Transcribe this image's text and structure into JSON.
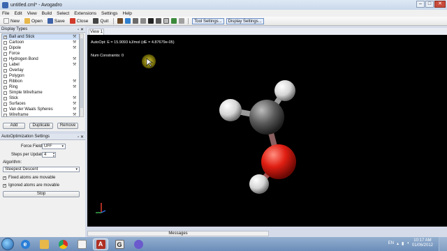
{
  "window": {
    "title": "untitled.cml* - Avogadro"
  },
  "menu": [
    "File",
    "Edit",
    "View",
    "Build",
    "Select",
    "Extensions",
    "Settings",
    "Help"
  ],
  "toolbar": {
    "new_label": "New",
    "open_label": "Open",
    "save_label": "Save",
    "close_label": "Close",
    "quit_label": "Quit",
    "tool_settings_label": "Tool Settings...",
    "display_settings_label": "Display Settings..."
  },
  "display_types": {
    "header": "Display Types",
    "items": [
      {
        "label": "Ball and Stick",
        "checked": true,
        "wrench": true,
        "selected": true
      },
      {
        "label": "Cartoon",
        "checked": false,
        "wrench": true
      },
      {
        "label": "Dipole",
        "checked": false,
        "wrench": true
      },
      {
        "label": "Force",
        "checked": false,
        "wrench": false
      },
      {
        "label": "Hydrogen Bond",
        "checked": false,
        "wrench": true
      },
      {
        "label": "Label",
        "checked": false,
        "wrench": true
      },
      {
        "label": "Overlay",
        "checked": false,
        "wrench": false
      },
      {
        "label": "Polygon",
        "checked": false,
        "wrench": false
      },
      {
        "label": "Ribbon",
        "checked": false,
        "wrench": true
      },
      {
        "label": "Ring",
        "checked": false,
        "wrench": true
      },
      {
        "label": "Simple Wireframe",
        "checked": false,
        "wrench": false
      },
      {
        "label": "Stick",
        "checked": false,
        "wrench": true
      },
      {
        "label": "Surfaces",
        "checked": false,
        "wrench": true
      },
      {
        "label": "Van der Waals Spheres",
        "checked": false,
        "wrench": true
      },
      {
        "label": "Wireframe",
        "checked": false,
        "wrench": true
      }
    ],
    "add_label": "Add",
    "duplicate_label": "Duplicate",
    "remove_label": "Remove"
  },
  "autoopt": {
    "header": "AutoOptimization Settings",
    "force_field_label": "Force Field:",
    "force_field_value": "UFF",
    "steps_label": "Steps per Update:",
    "steps_value": "4",
    "algorithm_label": "Algorithm:",
    "algorithm_value": "Steepest Descent",
    "fixed_label": "Fixed atoms are movable",
    "fixed_checked": true,
    "ignored_label": "Ignored atoms are movable",
    "ignored_checked": true,
    "stop_label": "Stop"
  },
  "view": {
    "tab_label": "View 1",
    "status_line": "AutoOpt: E = 15.9093 kJ/mol (dE = 4.87679e-05)",
    "constraints_line": "Num Constraints: 0"
  },
  "messages_label": "Messages",
  "taskbar": {
    "language": "EN",
    "time": "10:17 AM",
    "date": "01/06/2012"
  },
  "colors": {
    "carbon": "#5a5a5a",
    "oxygen": "#e01e12",
    "hydrogen": "#e8e8e8",
    "selection_highlight": "#cfe0f7"
  }
}
